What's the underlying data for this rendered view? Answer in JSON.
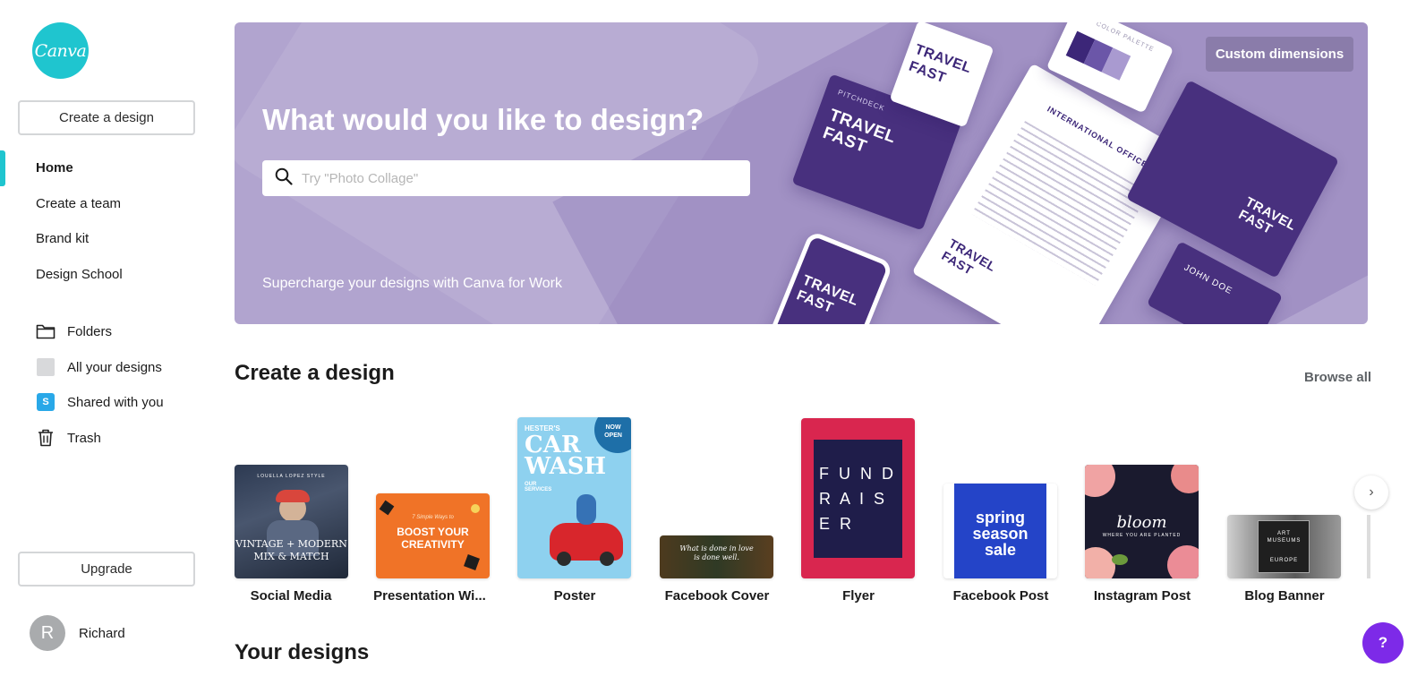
{
  "sidebar": {
    "logo_text": "Canva",
    "create_button": "Create a design",
    "nav": [
      {
        "label": "Home",
        "active": true
      },
      {
        "label": "Create a team"
      },
      {
        "label": "Brand kit"
      },
      {
        "label": "Design School"
      }
    ],
    "library": [
      {
        "label": "Folders",
        "icon": "folder-icon"
      },
      {
        "label": "All your designs",
        "icon": "all-designs-icon"
      },
      {
        "label": "Shared with you",
        "icon": "shared-icon",
        "icon_text": "S"
      },
      {
        "label": "Trash",
        "icon": "trash-icon"
      }
    ],
    "upgrade_button": "Upgrade",
    "user": {
      "initial": "R",
      "name": "Richard"
    }
  },
  "banner": {
    "title": "What would you like to design?",
    "search_placeholder": "Try \"Photo Collage\"",
    "subtitle": "Supercharge your designs with Canva for Work",
    "custom_button": "Custom dimensions",
    "art": {
      "travel": "TRAVEL",
      "fast": "FAST",
      "pitchdeck": "PITCHDECK",
      "intl_office": "INTERNATIONAL OFFICE",
      "color_palette": "COLOR PALETTE",
      "john_doe": "JOHN DOE"
    },
    "colors": {
      "background": "#b1a4cf",
      "brand_purple": "#48307e"
    }
  },
  "create_section": {
    "title": "Create a design",
    "browse_all": "Browse all",
    "items": [
      {
        "label": "Social Media",
        "thumb_text": [
          "LOUELLA LOPEZ STYLE",
          "VINTAGE + MODERN",
          "MIX & MATCH"
        ]
      },
      {
        "label": "Presentation Wi...",
        "thumb_text": [
          "7 Simple Ways to",
          "BOOST YOUR",
          "CREATIVITY"
        ]
      },
      {
        "label": "Poster",
        "thumb_text": [
          "HESTER'S",
          "CAR",
          "WASH",
          "NOW",
          "OPEN",
          "OUR SERVICES"
        ]
      },
      {
        "label": "Facebook Cover",
        "thumb_text": [
          "What is done in love",
          "is done well."
        ]
      },
      {
        "label": "Flyer",
        "thumb_text": [
          "F U N D",
          "R A I S",
          "E R"
        ]
      },
      {
        "label": "Facebook Post",
        "thumb_text": [
          "spring",
          "season",
          "sale"
        ]
      },
      {
        "label": "Instagram Post",
        "thumb_text": [
          "bloom",
          "WHERE YOU ARE PLANTED"
        ]
      },
      {
        "label": "Blog Banner",
        "thumb_text": [
          "ART",
          "MUSEUMS",
          "EUROPE"
        ]
      }
    ]
  },
  "your_designs": {
    "title": "Your designs"
  },
  "next_arrow": "›",
  "help_button": "?",
  "accent": "#1fc5cf"
}
